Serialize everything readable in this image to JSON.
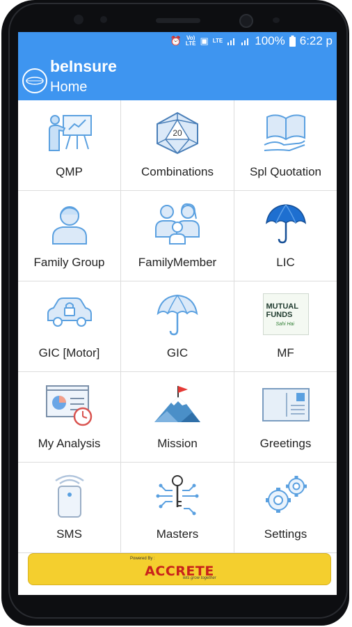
{
  "status_bar": {
    "battery": "100%",
    "time": "6:22 p",
    "network_volte": "Vo)\nLTE",
    "network_lte": "LTE"
  },
  "app": {
    "title": "beInsure",
    "subtitle": "Home"
  },
  "tiles": [
    {
      "label": "QMP",
      "icon": "presentation-icon"
    },
    {
      "label": "Combinations",
      "icon": "d20-dice-icon",
      "icon_text": "20"
    },
    {
      "label": "Spl Quotation",
      "icon": "open-book-hand-icon"
    },
    {
      "label": "Family Group",
      "icon": "user-icon"
    },
    {
      "label": "FamilyMember",
      "icon": "family-icon"
    },
    {
      "label": "LIC",
      "icon": "umbrella-filled-icon"
    },
    {
      "label": "GIC [Motor]",
      "icon": "car-lock-icon"
    },
    {
      "label": "GIC",
      "icon": "umbrella-icon"
    },
    {
      "label": "MF",
      "icon": "mutual-funds-icon",
      "icon_text": "MUTUAL FUNDS",
      "icon_subtext": "Sahi Hai"
    },
    {
      "label": "My Analysis",
      "icon": "analysis-clock-icon"
    },
    {
      "label": "Mission",
      "icon": "mountain-flag-icon"
    },
    {
      "label": "Greetings",
      "icon": "postcard-icon"
    },
    {
      "label": "SMS",
      "icon": "phone-signal-icon"
    },
    {
      "label": "Masters",
      "icon": "key-circuit-icon"
    },
    {
      "label": "Settings",
      "icon": "gears-icon"
    }
  ],
  "footer": {
    "powered_by": "Powered By :",
    "brand": "ACCRETE",
    "tagline": "lets grow together"
  },
  "colors": {
    "primary": "#3e95f0",
    "footer": "#f4cf2e",
    "icon_blue": "#5aa0e0"
  }
}
